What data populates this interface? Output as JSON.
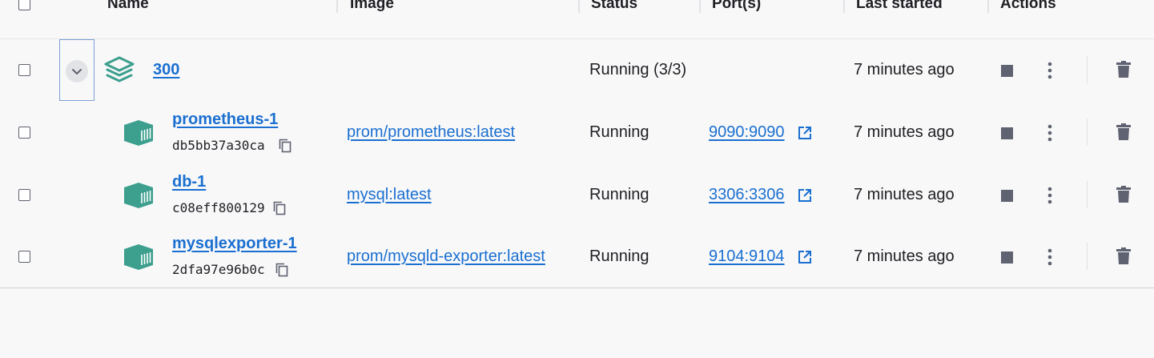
{
  "header": {
    "name": "Name",
    "image": "Image",
    "status": "Status",
    "ports": "Port(s)",
    "last_started": "Last started",
    "actions": "Actions"
  },
  "group": {
    "name": "300",
    "status": "Running (3/3)",
    "last_started": "7 minutes ago",
    "icon": "stack-layers-icon"
  },
  "containers": [
    {
      "name": "prometheus-1",
      "id": "db5bb37a30ca",
      "image": "prom/prometheus:latest",
      "status": "Running",
      "ports": "9090:9090",
      "last_started": "7 minutes ago"
    },
    {
      "name": "db-1",
      "id": "c08eff800129",
      "image": "mysql:latest",
      "status": "Running",
      "ports": "3306:3306",
      "last_started": "7 minutes ago"
    },
    {
      "name": "mysqlexporter-1",
      "id": "2dfa97e96b0c",
      "image": "prom/mysqld-exporter:latest",
      "status": "Running",
      "ports": "9104:9104",
      "last_started": "7 minutes ago"
    }
  ],
  "colors": {
    "accent_link": "#1a6fd0",
    "container_icon": "#3d9f8e",
    "action_icon": "#5f6270",
    "background": "#f8f8f9"
  }
}
